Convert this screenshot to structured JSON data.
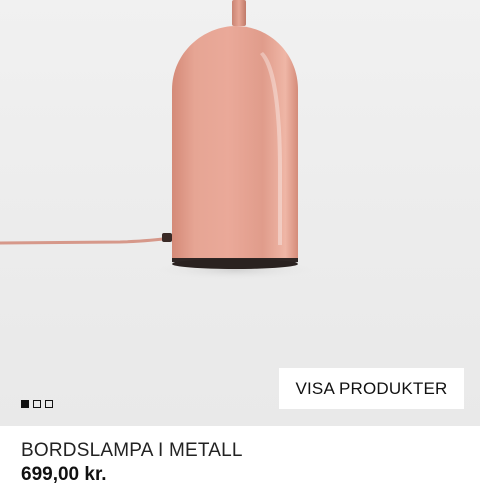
{
  "product_image": {
    "subject": "table-lamp-icon",
    "lamp_color": "#e3a190",
    "background_color": "#ededed"
  },
  "cta": {
    "label": "VISA PRODUKTER"
  },
  "carousel": {
    "count": 3,
    "active_index": 0
  },
  "product": {
    "name": "BORDSLAMPA I METALL",
    "price": "699,00 kr."
  }
}
